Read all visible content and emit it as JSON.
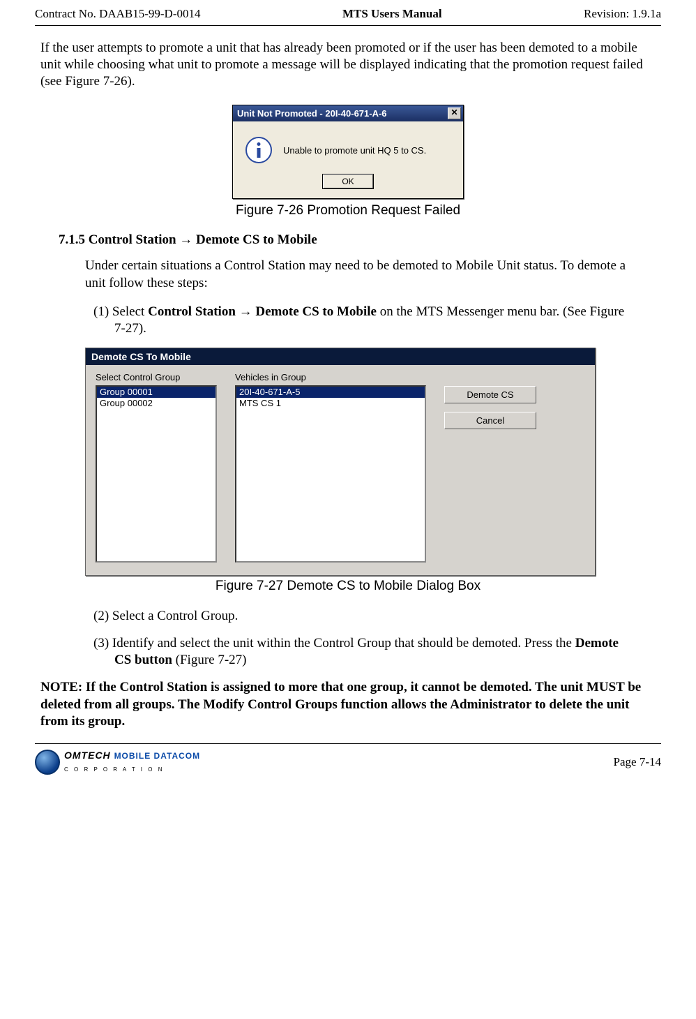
{
  "header": {
    "left": "Contract No. DAAB15-99-D-0014",
    "center": "MTS Users Manual",
    "right": "Revision:  1.9.1a"
  },
  "intro_para": "If the user attempts to promote a unit that has already been promoted or if the user has been demoted to a mobile unit while choosing what unit to promote a message will be displayed indicating that the promotion request failed (see Figure 7-26).",
  "fig26": {
    "title": "Unit Not Promoted - 20I-40-671-A-6",
    "close_glyph": "✕",
    "message": "Unable to promote unit HQ 5 to CS.",
    "ok_label": "OK",
    "caption": "Figure 7-26   Promotion Request Failed"
  },
  "section": {
    "heading": "7.1.5  Control Station → Demote CS to Mobile",
    "body": "Under certain situations a Control Station may need to be demoted to Mobile Unit status.  To demote a unit follow these steps:",
    "step1_num": "(1) ",
    "step1_a": "Select ",
    "step1_bold": "Control Station → Demote CS to Mobile",
    "step1_b": " on the MTS Messenger menu bar.   (See Figure 7-27)."
  },
  "fig27": {
    "title": "Demote CS To Mobile",
    "label_group": "Select Control Group",
    "label_vehicles": "Vehicles in Group",
    "groups": [
      "Group 00001",
      "Group 00002"
    ],
    "vehicles": [
      "20I-40-671-A-5",
      "MTS CS 1"
    ],
    "btn_demote": "Demote CS",
    "btn_cancel": "Cancel",
    "caption": "Figure 7-27   Demote CS to Mobile Dialog Box"
  },
  "steps_after": {
    "step2": "(2) Select a Control Group.",
    "step3_a": "(3) Identify and select the unit within the Control Group that should be demoted.  Press the ",
    "step3_bold": "Demote CS button",
    "step3_b": " (Figure 7-27)"
  },
  "note": "NOTE: If the Control Station is assigned to more that one group, it cannot be demoted. The unit MUST be deleted from all groups. The Modify Control Groups function allows the Administrator to delete the unit from its group.",
  "footer": {
    "logo_line1_a": "OMTECH ",
    "logo_line1_b": "MOBILE DATACOM",
    "logo_line2": "C O R P O R A T I O N",
    "page": "Page 7-14"
  }
}
